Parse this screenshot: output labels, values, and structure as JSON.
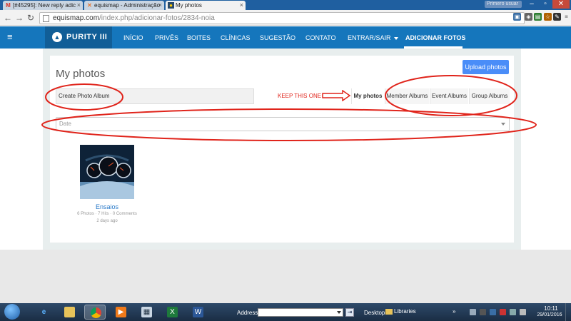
{
  "browser": {
    "tabs": [
      {
        "title": "[#45295]: New reply adic",
        "favicon": "gmail-icon",
        "active": false
      },
      {
        "title": "equismap - Administração",
        "favicon": "joomla-icon",
        "active": false
      },
      {
        "title": "My photos",
        "favicon": "site-icon",
        "active": true
      }
    ],
    "user_chip": "Primero usuar",
    "url_domain": "equismap.com",
    "url_path": "/index.php/adicionar-fotos/2834-noia"
  },
  "site": {
    "brand": "PURITY III",
    "nav": [
      {
        "label": "INÍCIO",
        "active": false
      },
      {
        "label": "PRIVÊS",
        "active": false
      },
      {
        "label": "BOITES",
        "active": false
      },
      {
        "label": "CLÍNICAS",
        "active": false
      },
      {
        "label": "SUGESTÃO",
        "active": false
      },
      {
        "label": "CONTATO",
        "active": false
      },
      {
        "label": "ENTRAR/SAIR",
        "active": false,
        "dropdown": true
      },
      {
        "label": "ADICIONAR FOTOS",
        "active": true
      }
    ]
  },
  "page": {
    "title": "My photos",
    "upload_button": "Upload photos",
    "create_album": "Create Photo Album",
    "annotation_note": "KEEP THIS ONE",
    "album_tabs": [
      {
        "label": "My photos",
        "active": true
      },
      {
        "label": "Member Albums",
        "active": false
      },
      {
        "label": "Event Albums",
        "active": false
      },
      {
        "label": "Group Albums",
        "active": false
      }
    ],
    "sort_select": "Date",
    "albums": [
      {
        "name": "Ensaios",
        "meta": "6 Photos · 7 Hits · 0 Comments",
        "date": "2 days ago"
      }
    ]
  },
  "taskbar": {
    "address_label": "Address",
    "address_value": "",
    "desktop_label": "Desktop",
    "libraries_label": "Libraries",
    "apps": [
      "ie-icon",
      "explorer-icon",
      "chrome-icon",
      "media-player-icon",
      "calculator-icon",
      "excel-icon",
      "word-icon"
    ],
    "time": "10:11",
    "date": "29/01/2016"
  },
  "colors": {
    "navbar": "#1576bc",
    "brand_bg": "#115e97",
    "upload_button": "#4a8df8",
    "annotation": "#e0241b",
    "link": "#2a7ac9"
  }
}
